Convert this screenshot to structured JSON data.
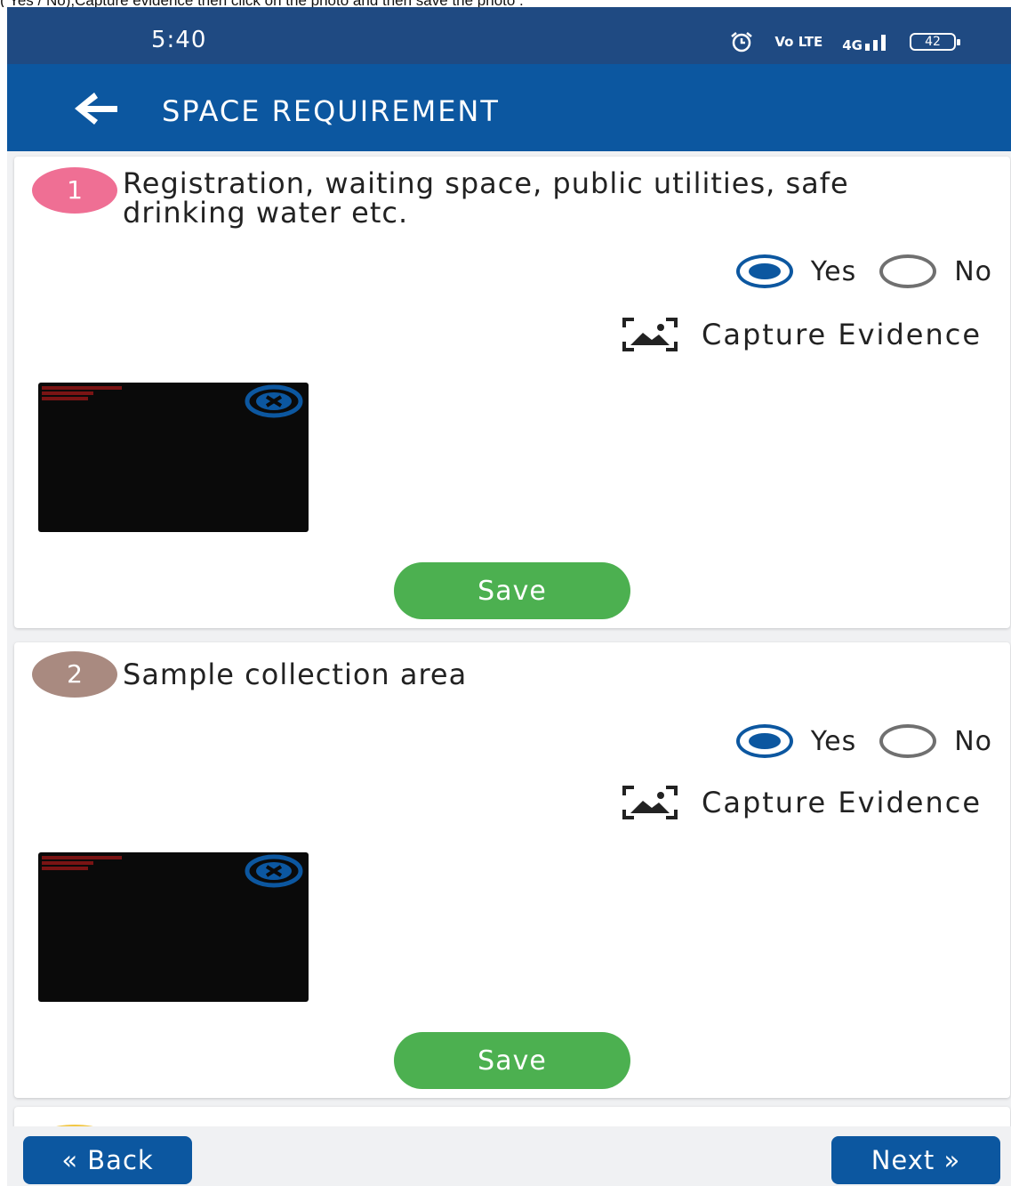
{
  "caption": "( Yes / No),Capture evidence then click on the photo and then save the photo .",
  "status_bar": {
    "time": "5:40",
    "volte": "Vo LTE",
    "network": "4G",
    "battery": "42"
  },
  "app_bar": {
    "title": "SPACE REQUIREMENT"
  },
  "questions": [
    {
      "number": "1",
      "text": "Registration, waiting space, public utilities, safe drinking water etc.",
      "options": [
        "Yes",
        "No"
      ],
      "selected": "Yes",
      "capture_label": "Capture Evidence",
      "save_label": "Save"
    },
    {
      "number": "2",
      "text": "Sample collection area",
      "options": [
        "Yes",
        "No"
      ],
      "selected": "Yes",
      "capture_label": "Capture Evidence",
      "save_label": "Save"
    }
  ],
  "nav": {
    "back_label": "« Back",
    "next_label": "Next »"
  },
  "colors": {
    "status_bar": "#1f4a82",
    "app_bar": "#0c57a0",
    "save_button": "#4cb050",
    "badge_1": "#ef6f94",
    "badge_2": "#a98a80",
    "badge_3": "#f2c744"
  },
  "icons": {
    "back": "arrow-left-icon",
    "capture": "image-capture-icon",
    "remove_photo": "close-circle-icon",
    "alarm": "alarm-icon",
    "signal": "signal-icon"
  }
}
